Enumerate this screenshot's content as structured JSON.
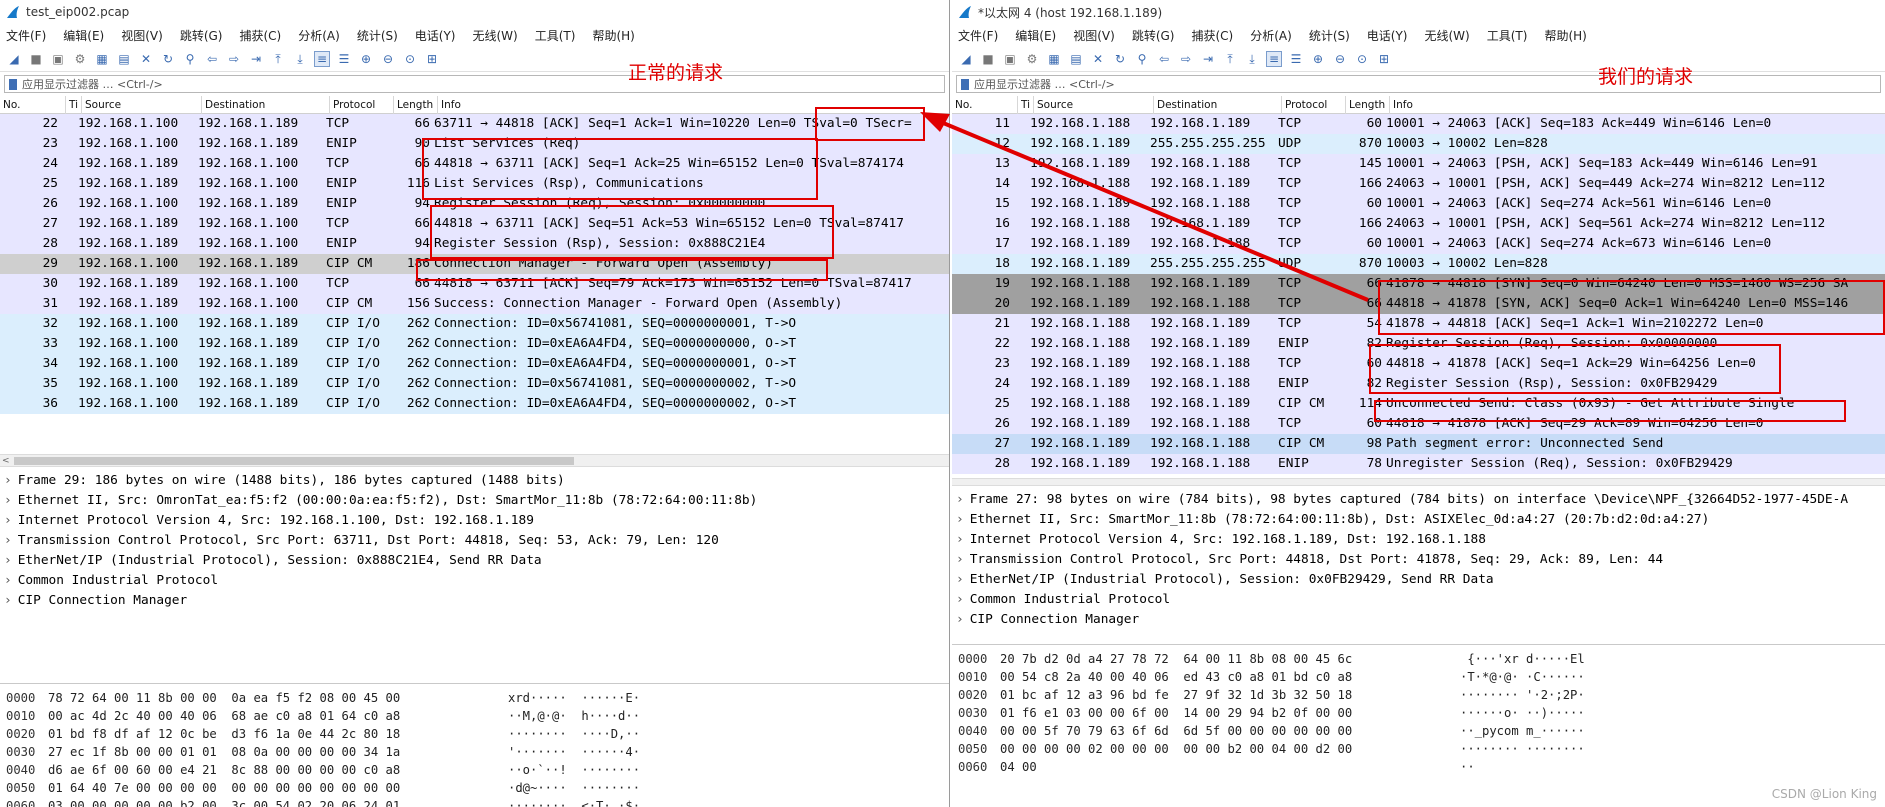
{
  "left": {
    "title": "test_eip002.pcap",
    "menu": [
      "文件(F)",
      "编辑(E)",
      "视图(V)",
      "跳转(G)",
      "捕获(C)",
      "分析(A)",
      "统计(S)",
      "电话(Y)",
      "无线(W)",
      "工具(T)",
      "帮助(H)"
    ],
    "filter_placeholder": "应用显示过滤器 … <Ctrl-/>",
    "columns": [
      "No.",
      "Ti",
      "Source",
      "Destination",
      "Protocol",
      "Length",
      "Info"
    ],
    "packets": [
      {
        "no": "22",
        "src": "192.168.1.100",
        "dst": "192.168.1.189",
        "proto": "TCP",
        "len": "66",
        "info": "63711 → 44818 [ACK] Seq=1 Ack=1 Win=10220 Len=0 TSval=0 TSecr=",
        "bg": "#e7e6ff"
      },
      {
        "no": "23",
        "src": "192.168.1.100",
        "dst": "192.168.1.189",
        "proto": "ENIP",
        "len": "90",
        "info": "List Services (Req)",
        "bg": "#e7e6ff"
      },
      {
        "no": "24",
        "src": "192.168.1.189",
        "dst": "192.168.1.100",
        "proto": "TCP",
        "len": "66",
        "info": "44818 → 63711 [ACK] Seq=1 Ack=25 Win=65152 Len=0 TSval=874174",
        "bg": "#e7e6ff"
      },
      {
        "no": "25",
        "src": "192.168.1.189",
        "dst": "192.168.1.100",
        "proto": "ENIP",
        "len": "116",
        "info": "List Services (Rsp), Communications",
        "bg": "#e7e6ff"
      },
      {
        "no": "26",
        "src": "192.168.1.100",
        "dst": "192.168.1.189",
        "proto": "ENIP",
        "len": "94",
        "info": "Register Session (Req), Session: 0x00000000",
        "bg": "#e7e6ff"
      },
      {
        "no": "27",
        "src": "192.168.1.189",
        "dst": "192.168.1.100",
        "proto": "TCP",
        "len": "66",
        "info": "44818 → 63711 [ACK] Seq=51 Ack=53 Win=65152 Len=0 TSval=87417",
        "bg": "#e7e6ff"
      },
      {
        "no": "28",
        "src": "192.168.1.189",
        "dst": "192.168.1.100",
        "proto": "ENIP",
        "len": "94",
        "info": "Register Session (Rsp), Session: 0x888C21E4",
        "bg": "#e7e6ff"
      },
      {
        "no": "29",
        "src": "192.168.1.100",
        "dst": "192.168.1.189",
        "proto": "CIP CM",
        "len": "186",
        "info": "Connection Manager - Forward Open (Assembly)",
        "bg": "#cfcfcf"
      },
      {
        "no": "30",
        "src": "192.168.1.189",
        "dst": "192.168.1.100",
        "proto": "TCP",
        "len": "66",
        "info": "44818 → 63711 [ACK] Seq=79 Ack=173 Win=65152 Len=0 TSval=87417",
        "bg": "#e7e6ff"
      },
      {
        "no": "31",
        "src": "192.168.1.189",
        "dst": "192.168.1.100",
        "proto": "CIP CM",
        "len": "156",
        "info": "Success: Connection Manager - Forward Open (Assembly)",
        "bg": "#e7e6ff"
      },
      {
        "no": "32",
        "src": "192.168.1.100",
        "dst": "192.168.1.189",
        "proto": "CIP I/O",
        "len": "262",
        "info": "Connection: ID=0x56741081, SEQ=0000000001, T->O",
        "bg": "#dbeefd"
      },
      {
        "no": "33",
        "src": "192.168.1.100",
        "dst": "192.168.1.189",
        "proto": "CIP I/O",
        "len": "262",
        "info": "Connection: ID=0xEA6A4FD4, SEQ=0000000000, O->T",
        "bg": "#dbeefd"
      },
      {
        "no": "34",
        "src": "192.168.1.100",
        "dst": "192.168.1.189",
        "proto": "CIP I/O",
        "len": "262",
        "info": "Connection: ID=0xEA6A4FD4, SEQ=0000000001, O->T",
        "bg": "#dbeefd"
      },
      {
        "no": "35",
        "src": "192.168.1.100",
        "dst": "192.168.1.189",
        "proto": "CIP I/O",
        "len": "262",
        "info": "Connection: ID=0x56741081, SEQ=0000000002, T->O",
        "bg": "#dbeefd"
      },
      {
        "no": "36",
        "src": "192.168.1.100",
        "dst": "192.168.1.189",
        "proto": "CIP I/O",
        "len": "262",
        "info": "Connection: ID=0xEA6A4FD4, SEQ=0000000002, O->T",
        "bg": "#dbeefd"
      }
    ],
    "details": [
      "Frame 29: 186 bytes on wire (1488 bits), 186 bytes captured (1488 bits)",
      "Ethernet II, Src: OmronTat_ea:f5:f2 (00:00:0a:ea:f5:f2), Dst: SmartMor_11:8b (78:72:64:00:11:8b)",
      "Internet Protocol Version 4, Src: 192.168.1.100, Dst: 192.168.1.189",
      "Transmission Control Protocol, Src Port: 63711, Dst Port: 44818, Seq: 53, Ack: 79, Len: 120",
      "EtherNet/IP (Industrial Protocol), Session: 0x888C21E4, Send RR Data",
      "Common Industrial Protocol",
      "CIP Connection Manager"
    ],
    "bytes": [
      {
        "off": "0000",
        "hex": "78 72 64 00 11 8b 00 00  0a ea f5 f2 08 00 45 00",
        "asc": "xrd·····  ······E·"
      },
      {
        "off": "0010",
        "hex": "00 ac 4d 2c 40 00 40 06  68 ae c0 a8 01 64 c0 a8",
        "asc": "··M,@·@·  h····d··"
      },
      {
        "off": "0020",
        "hex": "01 bd f8 df af 12 0c be  d3 f6 1a 0e 44 2c 80 18",
        "asc": "········  ····D,··"
      },
      {
        "off": "0030",
        "hex": "27 ec 1f 8b 00 00 01 01  08 0a 00 00 00 00 34 1a",
        "asc": "'·······  ······4·"
      },
      {
        "off": "0040",
        "hex": "d6 ae 6f 00 60 00 e4 21  8c 88 00 00 00 00 c0 a8",
        "asc": "··o·`··!  ········"
      },
      {
        "off": "0050",
        "hex": "01 64 40 7e 00 00 00 00  00 00 00 00 00 00 00 00",
        "asc": "·d@~····  ········"
      },
      {
        "off": "0060",
        "hex": "03 00 00 00 00 00 b2 00  3c 00 54 02 20 06 24 01",
        "asc": "········  <·T· ·$·"
      }
    ],
    "annotation": "正常的请求"
  },
  "right": {
    "title": "*以太网 4 (host 192.168.1.189)",
    "menu": [
      "文件(F)",
      "编辑(E)",
      "视图(V)",
      "跳转(G)",
      "捕获(C)",
      "分析(A)",
      "统计(S)",
      "电话(Y)",
      "无线(W)",
      "工具(T)",
      "帮助(H)"
    ],
    "filter_placeholder": "应用显示过滤器 … <Ctrl-/>",
    "columns": [
      "No.",
      "Ti",
      "Source",
      "Destination",
      "Protocol",
      "Length",
      "Info"
    ],
    "packets": [
      {
        "no": "11",
        "src": "192.168.1.188",
        "dst": "192.168.1.189",
        "proto": "TCP",
        "len": "60",
        "info": "10001 → 24063 [ACK] Seq=183 Ack=449 Win=6146 Len=0",
        "bg": "#e7e6ff"
      },
      {
        "no": "12",
        "src": "192.168.1.189",
        "dst": "255.255.255.255",
        "proto": "UDP",
        "len": "870",
        "info": "10003 → 10002 Len=828",
        "bg": "#dbeefd"
      },
      {
        "no": "13",
        "src": "192.168.1.189",
        "dst": "192.168.1.188",
        "proto": "TCP",
        "len": "145",
        "info": "10001 → 24063 [PSH, ACK] Seq=183 Ack=449 Win=6146 Len=91",
        "bg": "#e7e6ff"
      },
      {
        "no": "14",
        "src": "192.168.1.188",
        "dst": "192.168.1.189",
        "proto": "TCP",
        "len": "166",
        "info": "24063 → 10001 [PSH, ACK] Seq=449 Ack=274 Win=8212 Len=112",
        "bg": "#e7e6ff"
      },
      {
        "no": "15",
        "src": "192.168.1.189",
        "dst": "192.168.1.188",
        "proto": "TCP",
        "len": "60",
        "info": "10001 → 24063 [ACK] Seq=274 Ack=561 Win=6146 Len=0",
        "bg": "#e7e6ff"
      },
      {
        "no": "16",
        "src": "192.168.1.188",
        "dst": "192.168.1.189",
        "proto": "TCP",
        "len": "166",
        "info": "24063 → 10001 [PSH, ACK] Seq=561 Ack=274 Win=8212 Len=112",
        "bg": "#e7e6ff"
      },
      {
        "no": "17",
        "src": "192.168.1.189",
        "dst": "192.168.1.188",
        "proto": "TCP",
        "len": "60",
        "info": "10001 → 24063 [ACK] Seq=274 Ack=673 Win=6146 Len=0",
        "bg": "#e7e6ff"
      },
      {
        "no": "18",
        "src": "192.168.1.189",
        "dst": "255.255.255.255",
        "proto": "UDP",
        "len": "870",
        "info": "10003 → 10002 Len=828",
        "bg": "#dbeefd"
      },
      {
        "no": "19",
        "src": "192.168.1.188",
        "dst": "192.168.1.189",
        "proto": "TCP",
        "len": "66",
        "info": "41878 → 44818 [SYN] Seq=0 Win=64240 Len=0 MSS=1460 WS=256 SA",
        "bg": "#a0a0a0"
      },
      {
        "no": "20",
        "src": "192.168.1.189",
        "dst": "192.168.1.188",
        "proto": "TCP",
        "len": "66",
        "info": "44818 → 41878 [SYN, ACK] Seq=0 Ack=1 Win=64240 Len=0 MSS=146",
        "bg": "#a0a0a0"
      },
      {
        "no": "21",
        "src": "192.168.1.188",
        "dst": "192.168.1.189",
        "proto": "TCP",
        "len": "54",
        "info": "41878 → 44818 [ACK] Seq=1 Ack=1 Win=2102272 Len=0",
        "bg": "#e7e6ff"
      },
      {
        "no": "22",
        "src": "192.168.1.188",
        "dst": "192.168.1.189",
        "proto": "ENIP",
        "len": "82",
        "info": "Register Session (Req), Session: 0x00000000",
        "bg": "#e7e6ff"
      },
      {
        "no": "23",
        "src": "192.168.1.189",
        "dst": "192.168.1.188",
        "proto": "TCP",
        "len": "60",
        "info": "44818 → 41878 [ACK] Seq=1 Ack=29 Win=64256 Len=0",
        "bg": "#e7e6ff"
      },
      {
        "no": "24",
        "src": "192.168.1.189",
        "dst": "192.168.1.188",
        "proto": "ENIP",
        "len": "82",
        "info": "Register Session (Rsp), Session: 0x0FB29429",
        "bg": "#e7e6ff"
      },
      {
        "no": "25",
        "src": "192.168.1.188",
        "dst": "192.168.1.189",
        "proto": "CIP CM",
        "len": "114",
        "info": "Unconnected Send: Class (0x93) - Get Attribute Single",
        "bg": "#e7e6ff"
      },
      {
        "no": "26",
        "src": "192.168.1.189",
        "dst": "192.168.1.188",
        "proto": "TCP",
        "len": "60",
        "info": "44818 → 41878 [ACK] Seq=29 Ack=89 Win=64256 Len=0",
        "bg": "#e7e6ff"
      },
      {
        "no": "27",
        "src": "192.168.1.189",
        "dst": "192.168.1.188",
        "proto": "CIP CM",
        "len": "98",
        "info": "Path segment error: Unconnected Send",
        "bg": "#c7dcf7"
      },
      {
        "no": "28",
        "src": "192.168.1.189",
        "dst": "192.168.1.188",
        "proto": "ENIP",
        "len": "78",
        "info": "Unregister Session (Req), Session: 0x0FB29429",
        "bg": "#e7e6ff"
      }
    ],
    "details": [
      "Frame 27: 98 bytes on wire (784 bits), 98 bytes captured (784 bits) on interface \\Device\\NPF_{32664D52-1977-45DE-A",
      "Ethernet II, Src: SmartMor_11:8b (78:72:64:00:11:8b), Dst: ASIXElec_0d:a4:27 (20:7b:d2:0d:a4:27)",
      "Internet Protocol Version 4, Src: 192.168.1.189, Dst: 192.168.1.188",
      "Transmission Control Protocol, Src Port: 44818, Dst Port: 41878, Seq: 29, Ack: 89, Len: 44",
      "EtherNet/IP (Industrial Protocol), Session: 0x0FB29429, Send RR Data",
      "Common Industrial Protocol",
      "CIP Connection Manager"
    ],
    "bytes": [
      {
        "off": "0000",
        "hex": "20 7b d2 0d a4 27 78 72  64 00 11 8b 08 00 45 6c",
        "asc": " {···'xr d·····El"
      },
      {
        "off": "0010",
        "hex": "00 54 c8 2a 40 00 40 06  ed 43 c0 a8 01 bd c0 a8",
        "asc": "·T·*@·@· ·C······"
      },
      {
        "off": "0020",
        "hex": "01 bc af 12 a3 96 bd fe  27 9f 32 1d 3b 32 50 18",
        "asc": "········ '·2·;2P·"
      },
      {
        "off": "0030",
        "hex": "01 f6 e1 03 00 00 6f 00  14 00 29 94 b2 0f 00 00",
        "asc": "······o· ··)·····"
      },
      {
        "off": "0040",
        "hex": "00 00 5f 70 79 63 6f 6d  6d 5f 00 00 00 00 00 00",
        "asc": "··_pycom m_······"
      },
      {
        "off": "0050",
        "hex": "00 00 00 00 02 00 00 00  00 00 b2 00 04 00 d2 00",
        "asc": "········ ········"
      },
      {
        "off": "0060",
        "hex": "04 00",
        "asc": "··"
      }
    ],
    "annotation": "我们的请求"
  },
  "watermark": "CSDN @Lion King",
  "colors": {
    "annotation": "#e00000",
    "tcp": "#e7e6ff",
    "udp": "#dbeefd",
    "selected": "#cfcfcf",
    "syn": "#a0a0a0"
  }
}
